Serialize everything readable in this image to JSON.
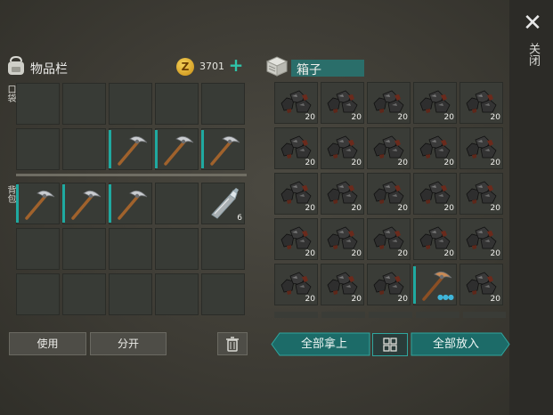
{
  "inventory": {
    "title": "物品栏",
    "coins": "3701",
    "pocket_label": "口袋",
    "backpack_label": "背包",
    "pocket_slots": [
      {
        "item": "",
        "count": ""
      },
      {
        "item": "",
        "count": ""
      },
      {
        "item": "",
        "count": ""
      },
      {
        "item": "",
        "count": ""
      },
      {
        "item": "",
        "count": ""
      },
      {
        "item": "",
        "count": ""
      },
      {
        "item": "",
        "count": ""
      },
      {
        "item": "pickaxe",
        "count": ""
      },
      {
        "item": "pickaxe",
        "count": ""
      },
      {
        "item": "pickaxe",
        "count": ""
      }
    ],
    "backpack_slots": [
      {
        "item": "pickaxe",
        "count": ""
      },
      {
        "item": "pickaxe",
        "count": ""
      },
      {
        "item": "pickaxe",
        "count": ""
      },
      {
        "item": "",
        "count": ""
      },
      {
        "item": "bottle",
        "count": "6"
      },
      {
        "item": "",
        "count": ""
      },
      {
        "item": "",
        "count": ""
      },
      {
        "item": "",
        "count": ""
      },
      {
        "item": "",
        "count": ""
      },
      {
        "item": "",
        "count": ""
      },
      {
        "item": "",
        "count": ""
      },
      {
        "item": "",
        "count": ""
      },
      {
        "item": "",
        "count": ""
      },
      {
        "item": "",
        "count": ""
      },
      {
        "item": "",
        "count": ""
      }
    ],
    "use_label": "使用",
    "split_label": "分开"
  },
  "box": {
    "title": "箱子",
    "slots": [
      {
        "item": "coal",
        "count": "20"
      },
      {
        "item": "coal",
        "count": "20"
      },
      {
        "item": "coal",
        "count": "20"
      },
      {
        "item": "coal",
        "count": "20"
      },
      {
        "item": "coal",
        "count": "20"
      },
      {
        "item": "coal",
        "count": "20"
      },
      {
        "item": "coal",
        "count": "20"
      },
      {
        "item": "coal",
        "count": "20"
      },
      {
        "item": "coal",
        "count": "20"
      },
      {
        "item": "coal",
        "count": "20"
      },
      {
        "item": "coal",
        "count": "20"
      },
      {
        "item": "coal",
        "count": "20"
      },
      {
        "item": "coal",
        "count": "20"
      },
      {
        "item": "coal",
        "count": "20"
      },
      {
        "item": "coal",
        "count": "20"
      },
      {
        "item": "coal",
        "count": "20"
      },
      {
        "item": "coal",
        "count": "20"
      },
      {
        "item": "coal",
        "count": "20"
      },
      {
        "item": "coal",
        "count": "20"
      },
      {
        "item": "coal",
        "count": "20"
      },
      {
        "item": "coal",
        "count": "20"
      },
      {
        "item": "coal",
        "count": "20"
      },
      {
        "item": "coal",
        "count": "20"
      },
      {
        "item": "pickaxe-copper",
        "count": ""
      },
      {
        "item": "coal",
        "count": "20"
      }
    ],
    "take_all_label": "全部拿上",
    "put_all_label": "全部放入"
  },
  "close_label": "关闭",
  "icons": {
    "backpack": "backpack-icon",
    "coin": "coin-icon",
    "plus": "plus-icon",
    "box": "box-icon",
    "close": "close-icon",
    "trash": "trash-icon",
    "sort": "sort-icon"
  },
  "colors": {
    "accent": "#1fa9a0",
    "coin": "#e8b52a",
    "box_title_bg": "#2a6e6a"
  }
}
